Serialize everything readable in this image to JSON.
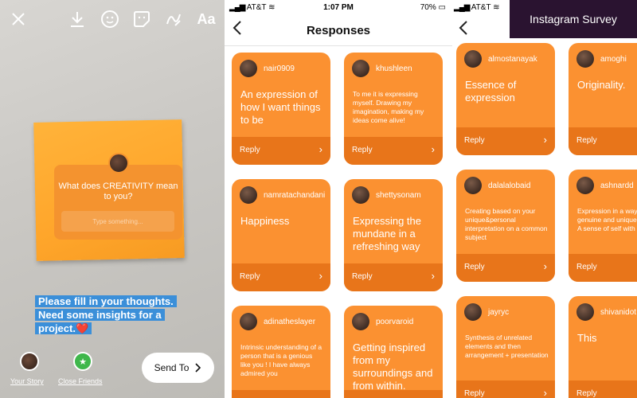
{
  "story": {
    "question": "What does CREATIVITY mean to you?",
    "input_placeholder": "Type something...",
    "caption": "Please fill in your thoughts. Need some insights for a project.❤️",
    "your_story_label": "Your Story",
    "close_friends_label": "Close Friends",
    "send_to_label": "Send To",
    "text_tool_label": "Aa",
    "accent_color": "#3b8fd9"
  },
  "status_bar": {
    "carrier": "AT&T",
    "time": "1:07 PM",
    "battery": "70%"
  },
  "responses": {
    "title": "Responses",
    "reply_label": "Reply",
    "cards": [
      {
        "user": "nair0909",
        "answer": "An expression of how I want things to be",
        "size": "big"
      },
      {
        "user": "khushleen",
        "answer": "To me it is expressing myself. Drawing my imagination, making my ideas come alive!",
        "size": "small"
      },
      {
        "user": "namratachandani",
        "answer": "Happiness",
        "size": "big"
      },
      {
        "user": "shettysonam",
        "answer": "Expressing the mundane in a refreshing way",
        "size": "big"
      },
      {
        "user": "adinatheslayer",
        "answer": "Intrinsic understanding of a person that is a genious like you ! I have always admired you",
        "size": "small"
      },
      {
        "user": "poorvaroid",
        "answer": "Getting inspired from my surroundings and from within.",
        "size": "big"
      }
    ]
  },
  "more_responses": {
    "banner": "Instagram Survey",
    "cards": [
      {
        "user": "almostanayak",
        "answer": "Essence of expression",
        "size": "big"
      },
      {
        "user": "amoghi",
        "answer": "Originality.",
        "size": "big"
      },
      {
        "user": "dalalalobaid",
        "answer": "Creating based on your unique&personal interpretation on a common subject",
        "size": "small"
      },
      {
        "user": "ashnardd",
        "answer": "Expression in a way that is genuine and unique to me! A sense of self with",
        "size": "small"
      },
      {
        "user": "jayryc",
        "answer": "Synthesis of unrelated elements and then arrangement + presentation",
        "size": "small"
      },
      {
        "user": "shivanidot",
        "answer": "This",
        "size": "big"
      }
    ]
  },
  "colors": {
    "card": "#fb9131",
    "reply_bar": "#e8751a",
    "banner": "#2a1330"
  }
}
